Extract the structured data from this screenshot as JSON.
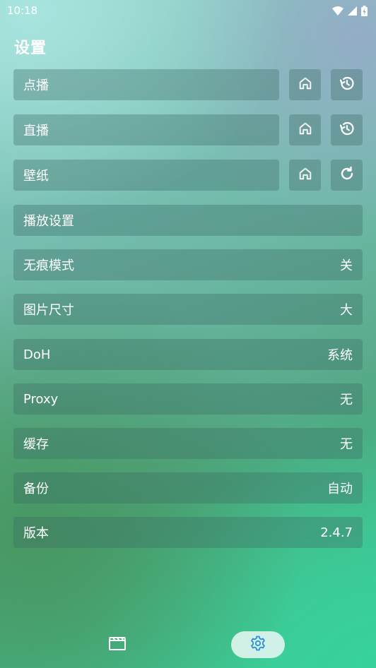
{
  "status_bar": {
    "time": "10:18"
  },
  "page_title": "设置",
  "rows": [
    {
      "label": "点播",
      "value": "",
      "icons": [
        "home-icon",
        "history-icon"
      ]
    },
    {
      "label": "直播",
      "value": "",
      "icons": [
        "home-icon",
        "history-icon"
      ]
    },
    {
      "label": "壁纸",
      "value": "",
      "icons": [
        "home-icon",
        "refresh-icon"
      ]
    },
    {
      "label": "播放设置",
      "value": ""
    },
    {
      "label": "无痕模式",
      "value": "关"
    },
    {
      "label": "图片尺寸",
      "value": "大"
    },
    {
      "label": "DoH",
      "value": "系统"
    },
    {
      "label": "Proxy",
      "value": "无"
    },
    {
      "label": "缓存",
      "value": "无"
    },
    {
      "label": "备份",
      "value": "自动"
    },
    {
      "label": "版本",
      "value": "2.4.7"
    }
  ],
  "bottom_nav": {
    "items": [
      {
        "icon": "clapperboard-icon",
        "selected": false
      },
      {
        "icon": "gear-icon",
        "selected": true
      }
    ]
  },
  "colors": {
    "active_nav_icon": "#2f8fd8",
    "text": "#ffffff"
  }
}
